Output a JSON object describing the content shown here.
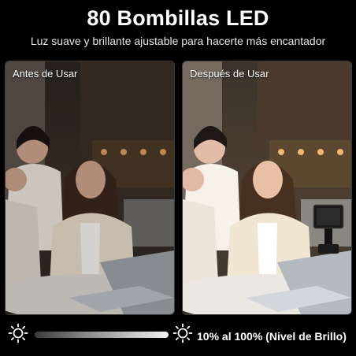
{
  "header": {
    "title": "80 Bombillas LED",
    "subtitle": "Luz suave y brillante ajustable para hacerte más encantador"
  },
  "panels": {
    "before_label": "Antes de Usar",
    "after_label": "Después de Usar"
  },
  "brightness": {
    "text": "10% al 100% (Nivel de Brillo)",
    "min_percent": 10,
    "max_percent": 100,
    "dim_icon": "sun-dim-icon",
    "bright_icon": "sun-bright-icon"
  }
}
